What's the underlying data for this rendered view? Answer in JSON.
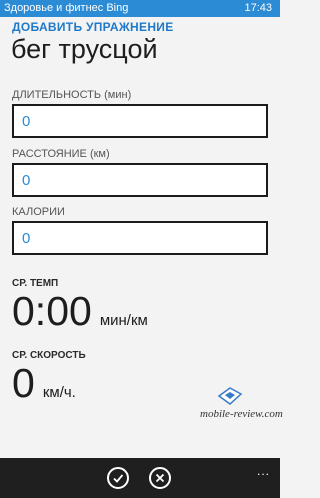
{
  "status_bar": {
    "app_name": "Здоровье и фитнес Bing",
    "time": "17:43"
  },
  "header": {
    "label": "ДОБАВИТЬ УПРАЖНЕНИЕ",
    "title": "бег трусцой"
  },
  "fields": [
    {
      "label": "ДЛИТЕЛЬНОСТЬ (мин)",
      "value": "0"
    },
    {
      "label": "РАССТОЯНИЕ (км)",
      "value": "0"
    },
    {
      "label": "КАЛОРИИ",
      "value": "0"
    }
  ],
  "stats": {
    "pace": {
      "label": "СР. ТЕМП",
      "value": "0:00",
      "unit": "мин/км"
    },
    "speed": {
      "label": "СР. СКОРОСТЬ",
      "value": "0",
      "unit": "км/ч."
    }
  },
  "watermark": {
    "text": "mobile-review.com"
  },
  "app_bar": {
    "buttons": [
      {
        "icon": "checkmark-icon"
      },
      {
        "icon": "close-icon"
      }
    ],
    "more": "..."
  },
  "colors": {
    "accent": "#2b8bd5",
    "background": "#f3f3f3",
    "app_bar": "#1f1f1f"
  }
}
